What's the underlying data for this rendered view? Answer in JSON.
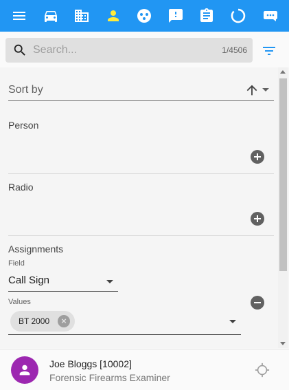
{
  "colors": {
    "appbar": "#2196f3",
    "active_icon": "#ffeb3b",
    "accent": "#2196f3",
    "avatar": "#9c27b0"
  },
  "toolbar": {
    "icons": [
      "menu-icon",
      "car-icon",
      "building-icon",
      "person-icon",
      "radio-icon",
      "alert-icon",
      "clipboard-icon",
      "progress-icon",
      "chat-icon"
    ],
    "active": "person-icon"
  },
  "search": {
    "placeholder": "Search...",
    "count": "1/4506"
  },
  "sort": {
    "label": "Sort by"
  },
  "sections": {
    "person": {
      "title": "Person"
    },
    "radio": {
      "title": "Radio"
    },
    "assignments": {
      "title": "Assignments",
      "field_label": "Field",
      "field_value": "Call Sign",
      "values_label": "Values",
      "chips": [
        {
          "label": "BT 2000"
        }
      ]
    }
  },
  "user": {
    "name": "Joe Bloggs [10002]",
    "role": "Forensic Firearms Examiner"
  }
}
